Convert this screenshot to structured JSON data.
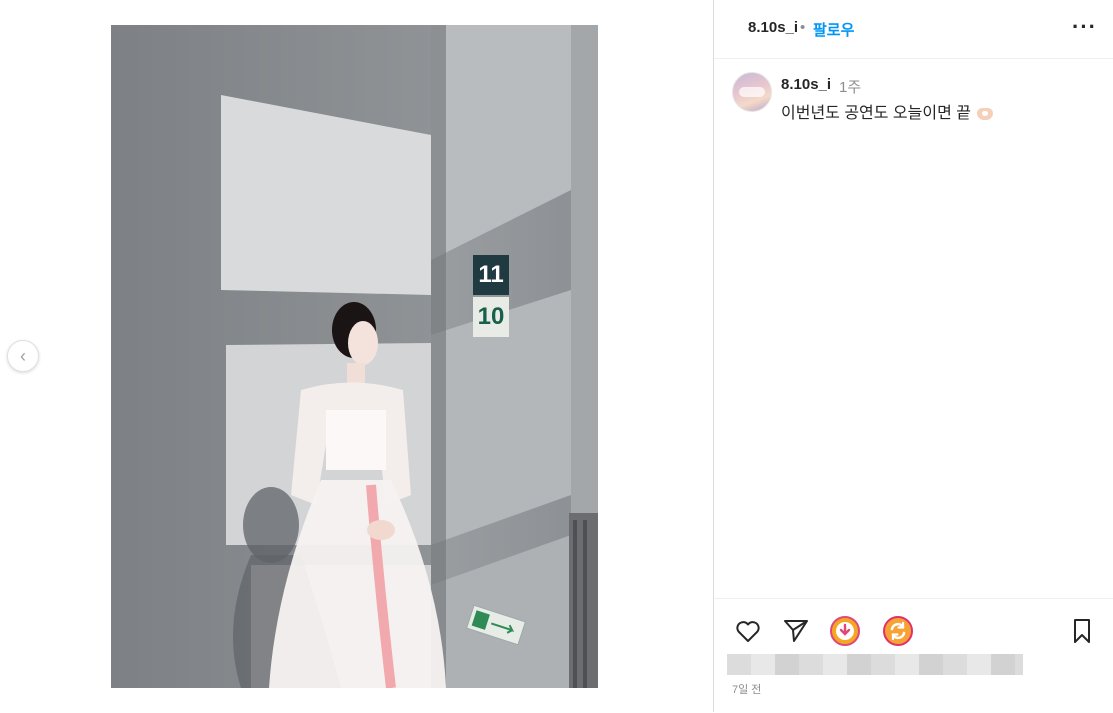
{
  "post": {
    "username": "8.10s_i",
    "follow_label": "팔로우",
    "dot": "•"
  },
  "caption": {
    "username": "8.10s_i",
    "time": "1주",
    "text": "이번년도 공연도 오늘이면 끝"
  },
  "photo": {
    "sign_top": "11",
    "sign_bottom": "10"
  },
  "date": "7일 전",
  "colors": {
    "follow": "#0095f6",
    "text": "#262626",
    "muted": "#8e8e8e"
  },
  "icons": {
    "more": "more-options-icon",
    "like": "heart-icon",
    "share": "paper-plane-icon",
    "ext1": "download-extension-icon",
    "ext2": "repost-extension-icon",
    "save": "bookmark-icon",
    "prev": "chevron-left-icon"
  }
}
